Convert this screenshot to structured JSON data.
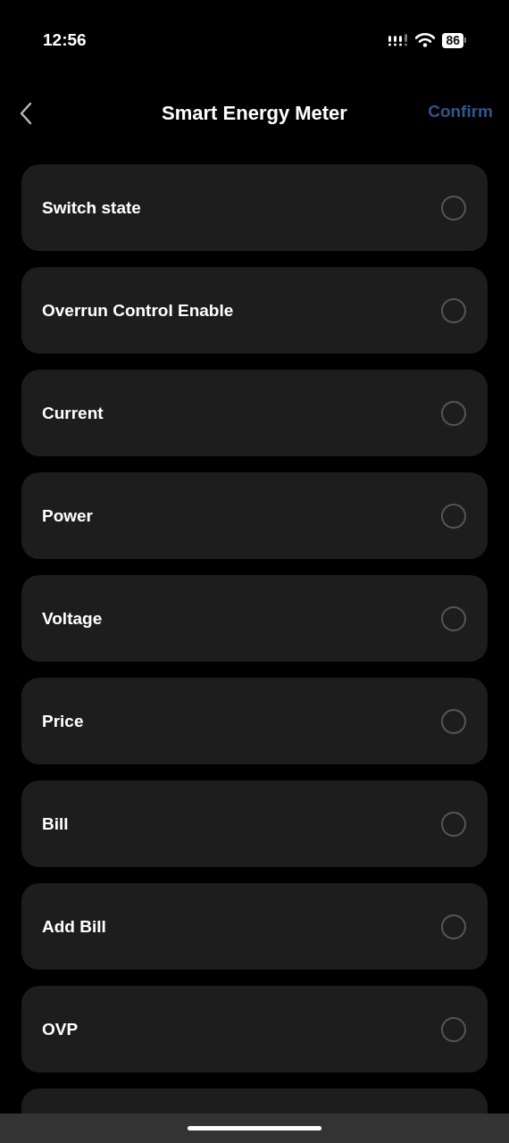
{
  "status_bar": {
    "time": "12:56",
    "battery": "86"
  },
  "header": {
    "title": "Smart Energy Meter",
    "confirm": {
      "label": "Confirm",
      "disabled": true
    }
  },
  "options": [
    {
      "label": "Switch state",
      "selected": false
    },
    {
      "label": "Overrun Control Enable",
      "selected": false
    },
    {
      "label": "Current",
      "selected": false
    },
    {
      "label": "Power",
      "selected": false
    },
    {
      "label": "Voltage",
      "selected": false
    },
    {
      "label": "Price",
      "selected": false
    },
    {
      "label": "Bill",
      "selected": false
    },
    {
      "label": "Add Bill",
      "selected": false
    },
    {
      "label": "OVP",
      "selected": false
    }
  ]
}
